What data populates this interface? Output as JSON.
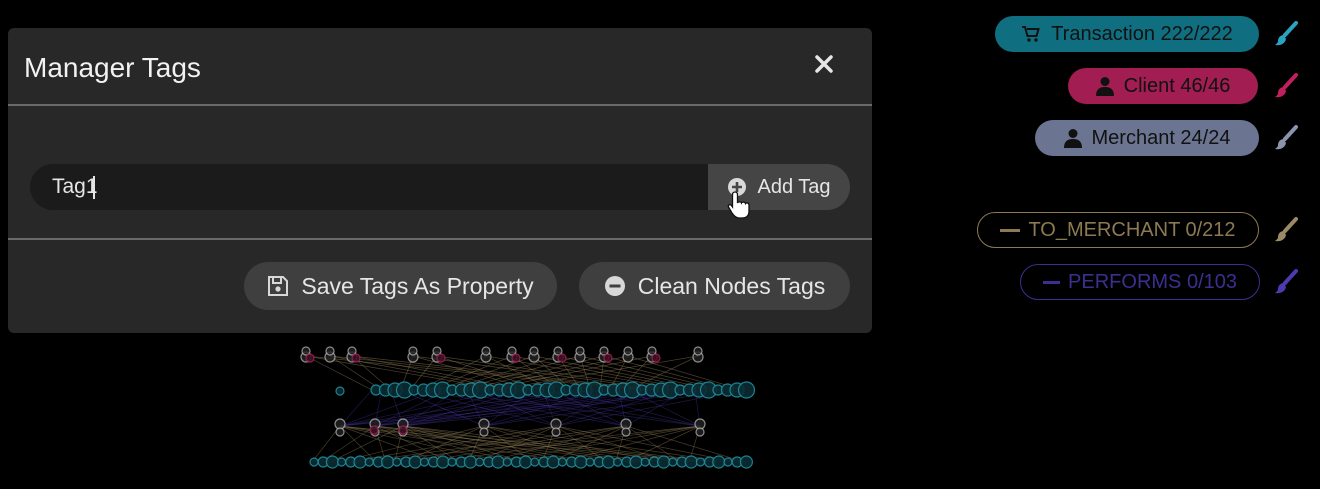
{
  "modal": {
    "title": "Manager Tags",
    "tag_input_value": "Tag1",
    "add_tag_label": "Add Tag",
    "save_label": "Save Tags As Property",
    "clean_label": "Clean Nodes Tags"
  },
  "legend": {
    "nodes": [
      {
        "label": "Transaction 222/222",
        "icon": "cart-icon",
        "color": "#0f6f80",
        "brush_color": "#2aa3c2"
      },
      {
        "label": "Client 46/46",
        "icon": "person-icon",
        "color": "#a11d52",
        "brush_color": "#c21f5f"
      },
      {
        "label": "Merchant 24/24",
        "icon": "person-icon",
        "color": "#6b7591",
        "brush_color": "#8b93ad"
      }
    ],
    "edges": [
      {
        "label": "TO_MERCHANT 0/212",
        "color": "#8c7a52",
        "brush_color": "#9a8a66"
      },
      {
        "label": "PERFORMS 0/103",
        "color": "#3b2f90",
        "brush_color": "#4b3ab0"
      }
    ]
  }
}
